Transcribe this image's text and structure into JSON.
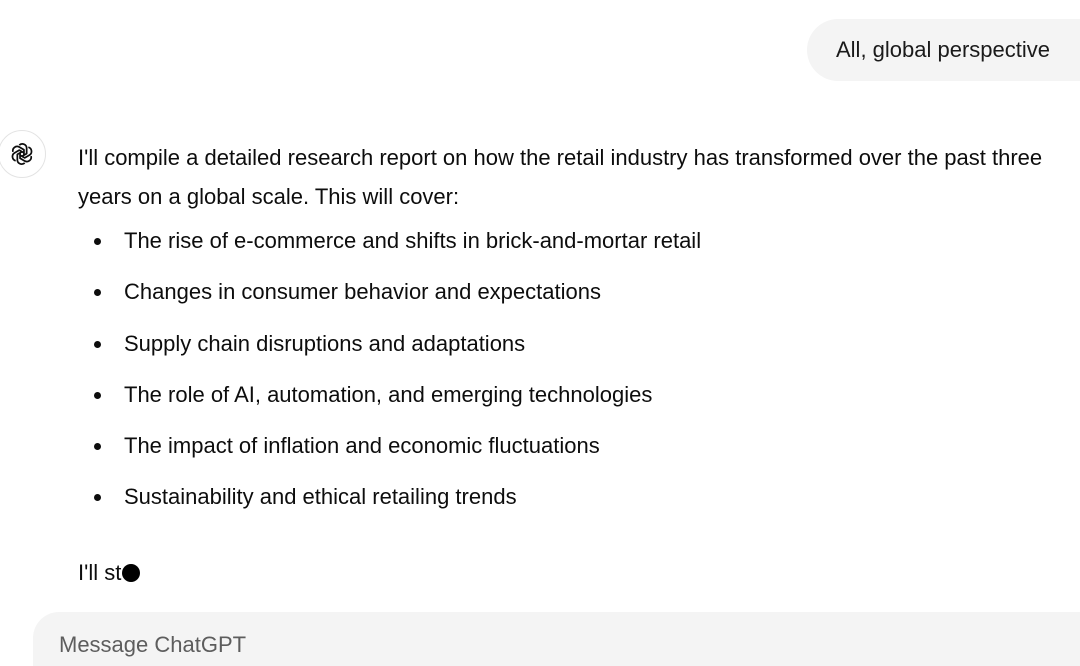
{
  "user_message": {
    "text": "All, global perspective"
  },
  "assistant_message": {
    "avatar_icon": "openai-logo-icon",
    "intro": "I'll compile a detailed research report on how the retail industry has transformed over the past three years on a global scale. This will cover:",
    "bullets": [
      "The rise of e-commerce and shifts in brick-and-mortar retail",
      "Changes in consumer behavior and expectations",
      "Supply chain disruptions and adaptations",
      "The role of AI, automation, and emerging technologies",
      "The impact of inflation and economic fluctuations",
      "Sustainability and ethical retailing trends"
    ],
    "streaming_text": "I'll st"
  },
  "composer": {
    "placeholder": "Message ChatGPT"
  }
}
